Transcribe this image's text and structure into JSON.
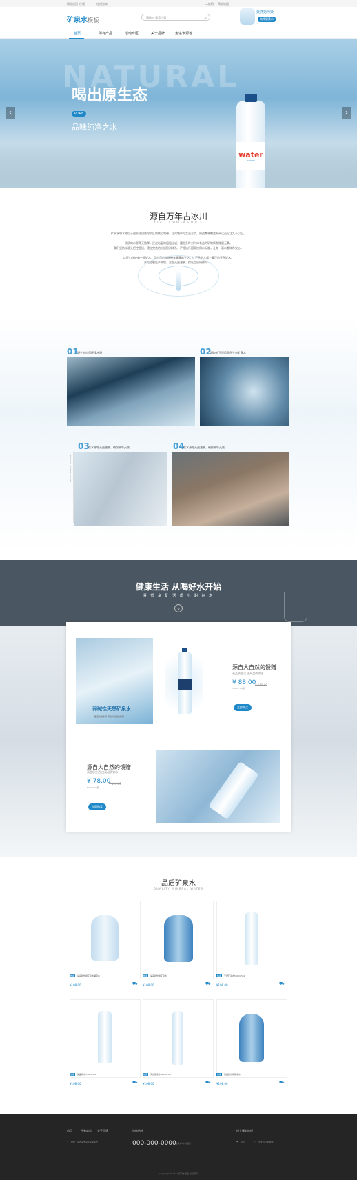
{
  "topbar": {
    "links": [
      "网站首页",
      "在线",
      "在线咨询"
    ],
    "right": [
      "二维码",
      "网站地图"
    ]
  },
  "header": {
    "logo_main": "矿泉水",
    "logo_sub": "模板",
    "search_placeholder": "请输入 搜索内容",
    "badge_title": "天然无污染",
    "badge_sub": "纯净健康水"
  },
  "nav": {
    "items": [
      "首页",
      "所有产品",
      "活动专区",
      "关于品牌",
      "走进水源地"
    ],
    "active": 0
  },
  "hero": {
    "big_text": "NATURAL",
    "headline": "喝出原生态",
    "pill": "PURE",
    "subline": "品味纯净之水",
    "bottle_label": "water",
    "bottle_sub": "NATURA",
    "prev": "‹",
    "next": "›"
  },
  "source": {
    "title": "源自万年古冰川",
    "subtitle": "QUALITY WATER SOURCE",
    "paragraphs": [
      "矿泉水取水地位于国家级自然保护区的核心地带，远离城市与工业污染，周边森林覆盖率高达百分之九十以上。",
      "优质的水源得天独厚，经过岩层的层层过滤，富含多种对人体有益的矿物质和微量元素。",
      "我们坚持从源头把控品质，建立完善的水质检测体系，严格执行国家饮用水标准，让每一滴水都纯净安心。",
      "以匠心守护每一瓶好水，用自然的馈赠带来健康的生活，让更多的人喝上真正的天然好水。",
      "严格控制生产流程，全程无菌灌装，保证品质始终如一。"
    ]
  },
  "features": [
    {
      "num": "01",
      "text": "源生态自然环境水源"
    },
    {
      "num": "02",
      "text": "源取地下深层天然生态矿泉水"
    },
    {
      "num": "03",
      "text": "在水源地无菌灌装，确保原味天然"
    },
    {
      "num": "04",
      "text": "在水源地无菌灌装，确保原味天然"
    }
  ],
  "vertical_text": "NATURAL MINERAL WATER",
  "band": {
    "title": "健康生活 从喝好水开始",
    "subtitle": "喜 低 富 矿 活 质 小 甜 好 水",
    "chevron": "⌄"
  },
  "showcase": {
    "img_label": "弱碱性天然矿泉水",
    "img_sub": "甄选天然水源 源自大自然的馈赠",
    "p1": {
      "title": "源自大自然的馈赠",
      "sub": "高品质生活 由高品质饮水",
      "price": "¥ 88.00",
      "old": "¥ 110.00",
      "note": "500ml*24瓶",
      "button": "立即购买"
    },
    "p2": {
      "title": "源自大自然的馈赠",
      "sub": "高品质生活 由高品质饮水",
      "price": "¥ 78.00",
      "old": "¥ 110.00",
      "note": "500ml*24瓶",
      "button": "立即购买"
    }
  },
  "products": {
    "title": "品质矿泉水",
    "subtitle": "QUALITY MINERAL WATER",
    "tag": "热卖",
    "items": [
      {
        "name": "某品牌饮用矿泉水桶装水",
        "price": "¥108.00"
      },
      {
        "name": "某品牌饮用矿泉水",
        "price": "¥108.00"
      },
      {
        "name": "天然矿泉水500ml*24",
        "price": "¥108.00"
      },
      {
        "name": "某品牌水550ml*24",
        "price": "¥108.00"
      },
      {
        "name": "天然矿泉水500ml*24",
        "price": "¥108.00"
      },
      {
        "name": "某品牌饮用矿泉水",
        "price": "¥108.00"
      }
    ]
  },
  "footer": {
    "nav": [
      "首页",
      "所有商品",
      "关于品牌"
    ],
    "address": "地址：某省某市某区某路某号",
    "hotline_label": "咨询热线",
    "phone": "000-000-0000",
    "hotline_note": "全天24小时服务",
    "follow": "线上服务热线",
    "qq": "QQ",
    "wechat": "全天24小时服务",
    "copyright": "Copyright © 2024 矿泉水模板 版权所有"
  }
}
